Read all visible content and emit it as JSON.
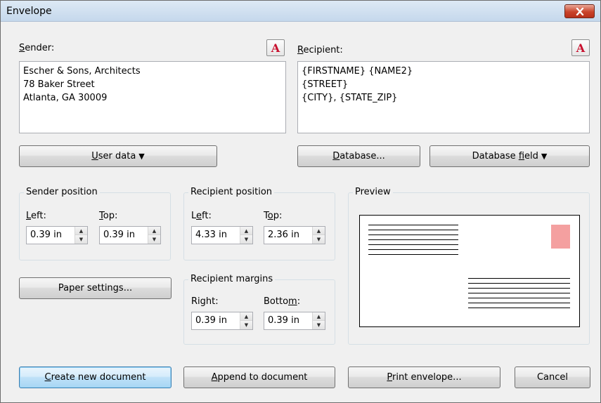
{
  "window": {
    "title": "Envelope"
  },
  "sender": {
    "label": "Sender:",
    "label_accel": "S",
    "label_rest": "ender:",
    "text": "Escher & Sons, Architects\n78 Baker Street\nAtlanta, GA 30009",
    "font_button": "A"
  },
  "recipient": {
    "label_accel": "R",
    "label_rest": "ecipient:",
    "text": "{FIRSTNAME} {NAME2}\n{STREET}\n{CITY}, {STATE_ZIP}",
    "font_button": "A"
  },
  "buttons": {
    "user_data_accel": "U",
    "user_data_rest": "ser data",
    "database_accel": "D",
    "database_rest": "atabase...",
    "database_field_pre": "Database ",
    "database_field_accel": "f",
    "database_field_post": "ield",
    "paper_settings": "Paper settings...",
    "create_accel": "C",
    "create_rest": "reate new document",
    "append_accel": "A",
    "append_rest": "ppend to document",
    "print_accel": "P",
    "print_rest": "rint envelope...",
    "cancel": "Cancel",
    "dropdown_arrow": "▼"
  },
  "sender_position": {
    "title": "Sender position",
    "left_accel": "L",
    "left_rest": "eft:",
    "top_accel": "T",
    "top_rest": "op:",
    "left_value": "0.39 in",
    "top_value": "0.39 in"
  },
  "recipient_position": {
    "title": "Recipient position",
    "left_pre": "L",
    "left_accel": "e",
    "left_post": "ft:",
    "top_pre": "T",
    "top_accel": "o",
    "top_post": "p:",
    "left_value": "4.33 in",
    "top_value": "2.36 in"
  },
  "recipient_margins": {
    "title": "Recipient margins",
    "right_label": "Right:",
    "bottom_pre": "Botto",
    "bottom_accel": "m",
    "bottom_post": ":",
    "right_value": "0.39 in",
    "bottom_value": "0.39 in"
  },
  "preview": {
    "title": "Preview",
    "stamp_color": "#f4a0a0"
  },
  "colors": {
    "close_button": "#c9432a",
    "default_button_border": "#3c7fb1",
    "font_icon": "#c8102e"
  }
}
